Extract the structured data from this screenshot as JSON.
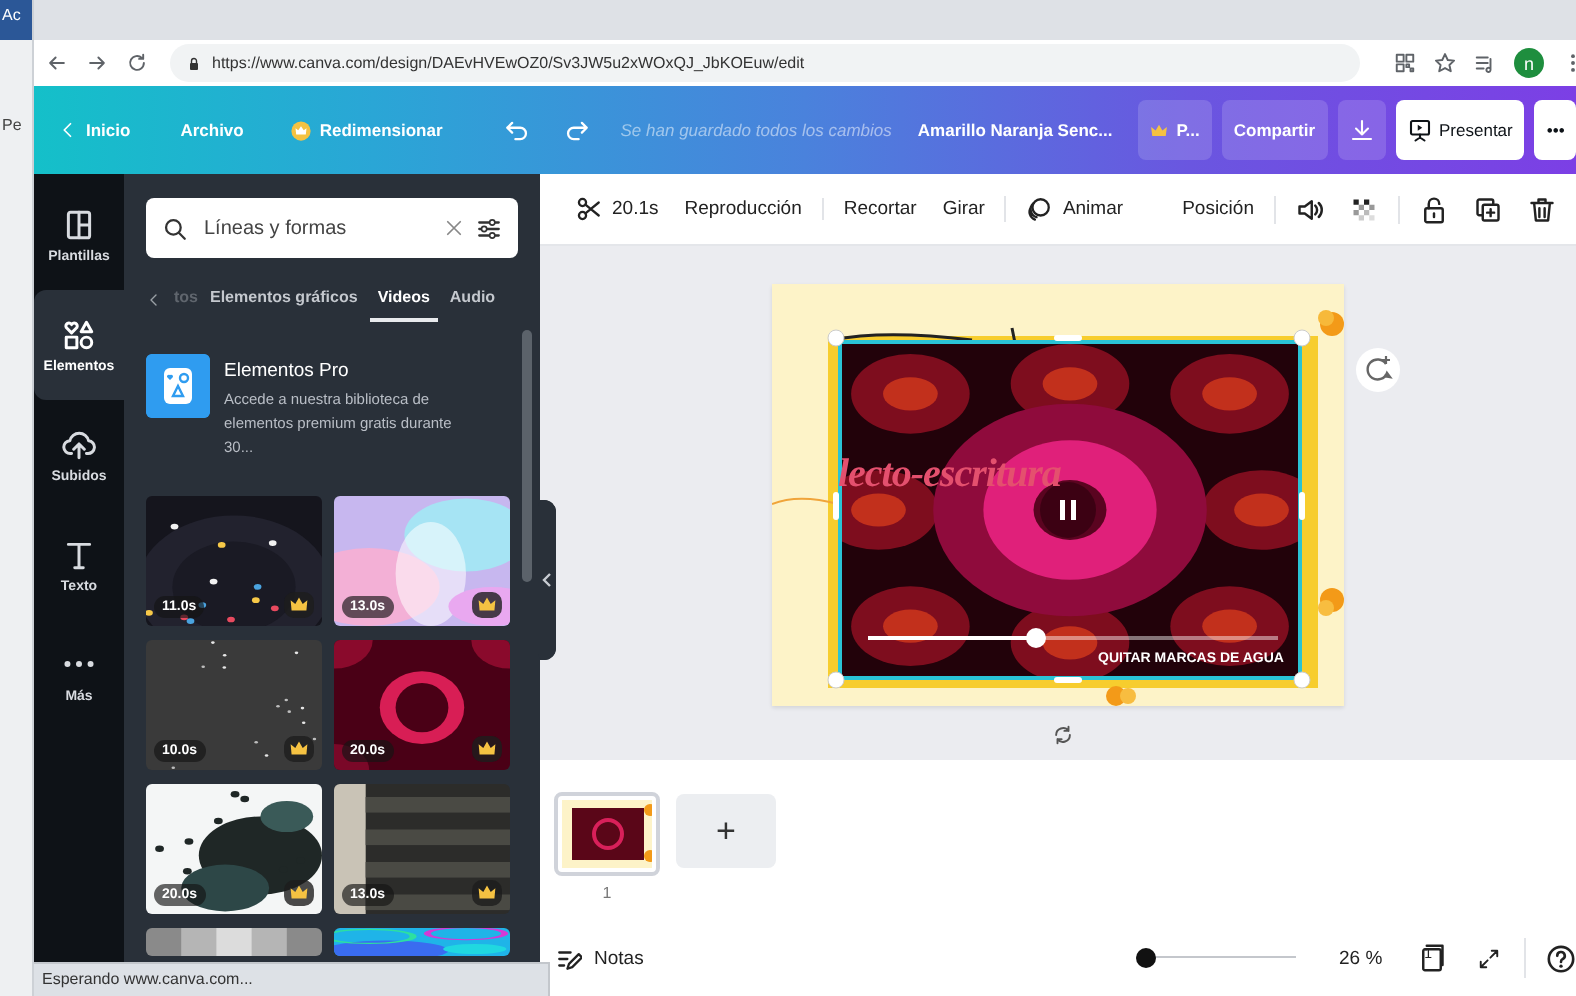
{
  "background_window": {
    "labels": [
      "Ac",
      "Pe"
    ]
  },
  "browser": {
    "url": "https://www.canva.com/design/DAEvHVEwOZ0/Sv3JW5u2xWOxQJ_JbKOEuw/edit",
    "profile_initial": "n"
  },
  "topbar": {
    "home": "Inicio",
    "file": "Archivo",
    "resize": "Redimensionar",
    "save_status": "Se han guardado todos los cambios",
    "design_title": "Amarillo Naranja Senc...",
    "pro": "P...",
    "share": "Compartir",
    "present": "Presentar",
    "more": "•••"
  },
  "sidebar": {
    "items": [
      {
        "kind": "templates",
        "label": "Plantillas",
        "selected": false
      },
      {
        "kind": "elements",
        "label": "Elementos",
        "selected": true
      },
      {
        "kind": "uploads",
        "label": "Subidos",
        "selected": false
      },
      {
        "kind": "text",
        "label": "Texto",
        "selected": false
      },
      {
        "kind": "more",
        "label": "Más",
        "selected": false
      }
    ]
  },
  "panel": {
    "search": {
      "value": "Líneas y formas"
    },
    "tabs": [
      {
        "label": "tos",
        "selected": false
      },
      {
        "label": "Elementos gráficos",
        "selected": false
      },
      {
        "label": "Videos",
        "selected": true
      },
      {
        "label": "Audio",
        "selected": false
      }
    ],
    "promo": {
      "title": "Elementos Pro",
      "description": "Accede a nuestra biblioteca de elementos premium gratis durante 30..."
    },
    "videos": [
      {
        "kind": "picture",
        "duration": "11.0s",
        "premium": true
      },
      {
        "kind": "picture",
        "duration": "13.0s",
        "premium": true
      },
      {
        "kind": "picture",
        "duration": "10.0s",
        "premium": true
      },
      {
        "kind": "picture",
        "duration": "20.0s",
        "premium": true
      },
      {
        "kind": "picture",
        "duration": "20.0s",
        "premium": true
      },
      {
        "kind": "picture",
        "duration": "13.0s",
        "premium": true
      },
      {
        "kind": "picture"
      },
      {
        "kind": "picture"
      }
    ]
  },
  "toolbar": {
    "left": [
      [
        {
          "kind": "trim",
          "label": "20.1s"
        },
        {
          "kind": "text",
          "label": "Reproducción"
        }
      ],
      [
        {
          "kind": "text",
          "label": "Recortar"
        },
        {
          "kind": "text",
          "label": "Girar"
        }
      ],
      [
        {
          "kind": "animate",
          "label": "Animar"
        }
      ]
    ],
    "right": [
      [
        {
          "kind": "text",
          "label": "Posición"
        }
      ],
      [
        {
          "kind": "volume"
        },
        {
          "kind": "transparency"
        }
      ],
      [
        {
          "kind": "lock"
        },
        {
          "kind": "duplicate"
        },
        {
          "kind": "delete"
        }
      ]
    ]
  },
  "design": {
    "heading": "lecto-escritura",
    "video": {
      "playing": true,
      "level": 0.41,
      "action": "QUITAR MARCAS DE AGUA"
    }
  },
  "pages": {
    "items": [
      {
        "number": "1",
        "selected": true
      }
    ],
    "add": "+"
  },
  "footer": {
    "notes": "Notas",
    "zoom": {
      "level": 0,
      "reading": "26 %"
    },
    "page_count": "1"
  },
  "status_bar": "Esperando www.canva.com..."
}
